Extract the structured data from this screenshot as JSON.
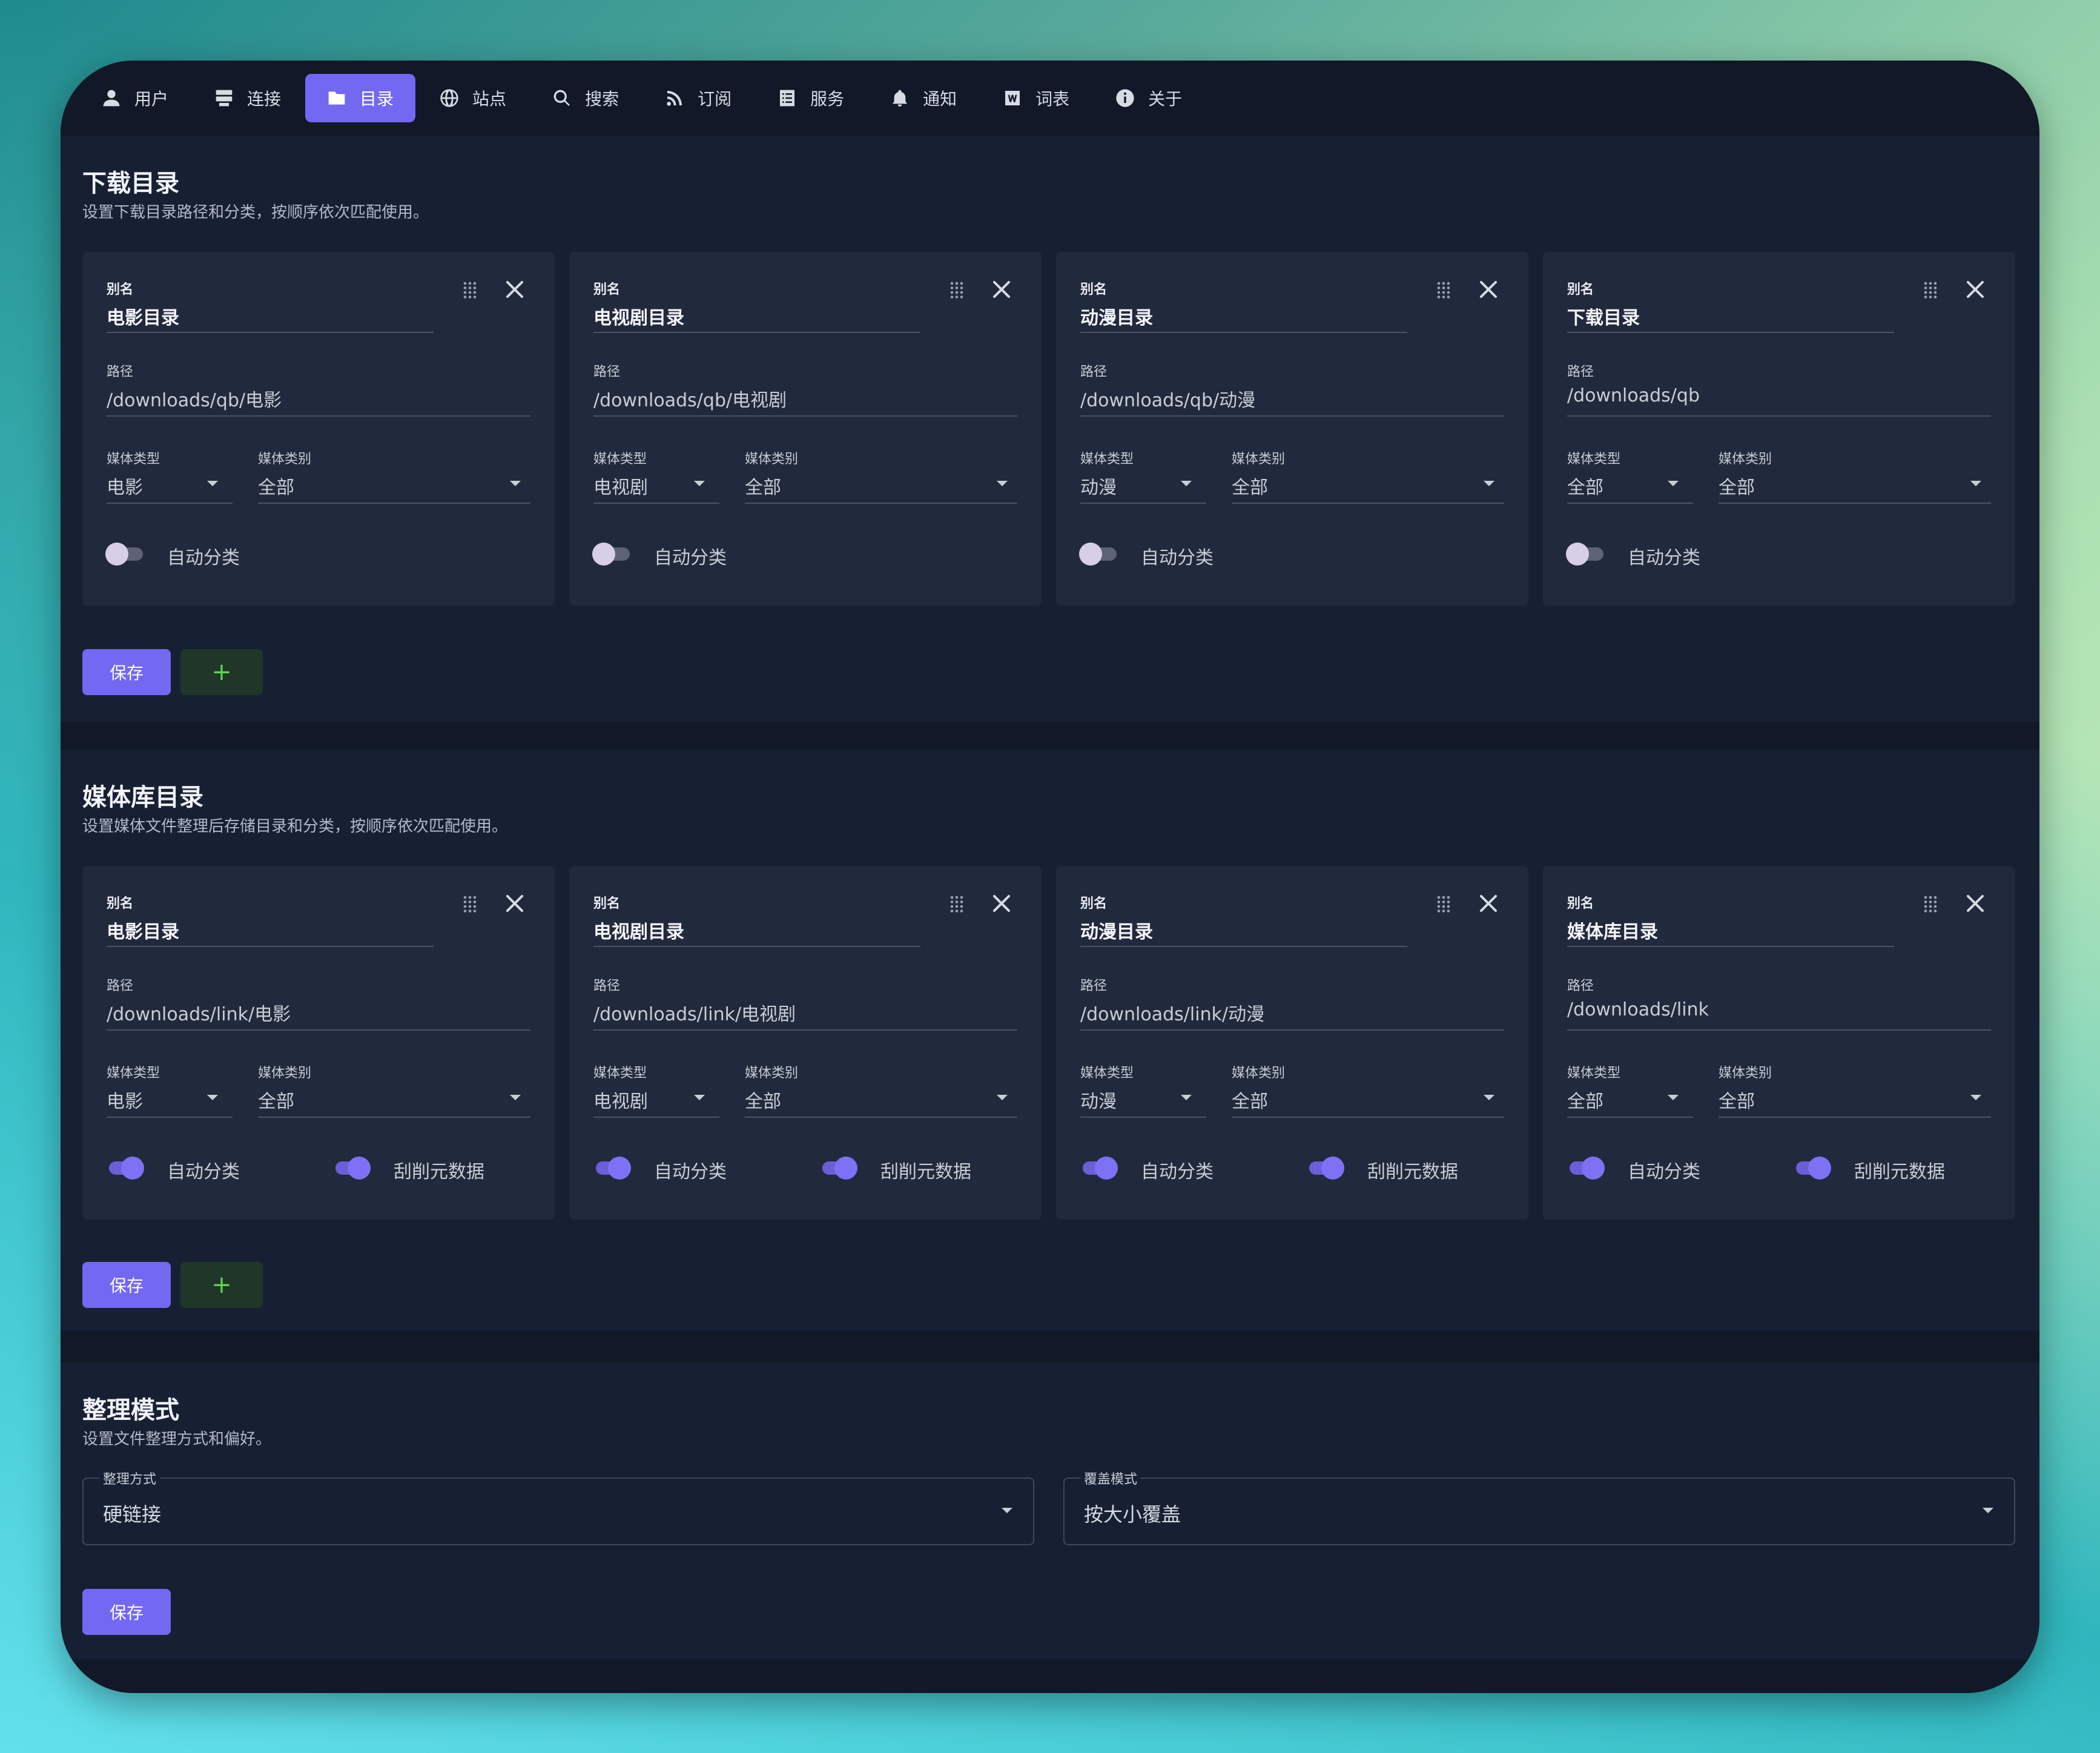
{
  "nav": {
    "tabs": [
      {
        "label": "用户",
        "icon": "user-icon",
        "active": false
      },
      {
        "label": "连接",
        "icon": "server-icon",
        "active": false
      },
      {
        "label": "目录",
        "icon": "folder-icon",
        "active": true
      },
      {
        "label": "站点",
        "icon": "globe-icon",
        "active": false
      },
      {
        "label": "搜索",
        "icon": "search-icon",
        "active": false
      },
      {
        "label": "订阅",
        "icon": "rss-icon",
        "active": false
      },
      {
        "label": "服务",
        "icon": "list-icon",
        "active": false
      },
      {
        "label": "通知",
        "icon": "bell-icon",
        "active": false
      },
      {
        "label": "词表",
        "icon": "word-icon",
        "active": false
      },
      {
        "label": "关于",
        "icon": "info-icon",
        "active": false
      }
    ]
  },
  "labels": {
    "alias": "别名",
    "path": "路径",
    "media_type": "媒体类型",
    "media_category": "媒体类别",
    "auto_category": "自动分类",
    "scrape": "刮削元数据",
    "save": "保存",
    "add": "+"
  },
  "download": {
    "title": "下载目录",
    "desc": "设置下载目录路径和分类，按顺序依次匹配使用。",
    "cards": [
      {
        "alias": "电影目录",
        "path": "/downloads/qb/电影",
        "type": "电影",
        "category": "全部",
        "auto": false
      },
      {
        "alias": "电视剧目录",
        "path": "/downloads/qb/电视剧",
        "type": "电视剧",
        "category": "全部",
        "auto": false
      },
      {
        "alias": "动漫目录",
        "path": "/downloads/qb/动漫",
        "type": "动漫",
        "category": "全部",
        "auto": false
      },
      {
        "alias": "下载目录",
        "path": "/downloads/qb",
        "type": "全部",
        "category": "全部",
        "auto": false
      }
    ]
  },
  "library": {
    "title": "媒体库目录",
    "desc": "设置媒体文件整理后存储目录和分类，按顺序依次匹配使用。",
    "cards": [
      {
        "alias": "电影目录",
        "path": "/downloads/link/电影",
        "type": "电影",
        "category": "全部",
        "auto": true,
        "scrape": true
      },
      {
        "alias": "电视剧目录",
        "path": "/downloads/link/电视剧",
        "type": "电视剧",
        "category": "全部",
        "auto": true,
        "scrape": true
      },
      {
        "alias": "动漫目录",
        "path": "/downloads/link/动漫",
        "type": "动漫",
        "category": "全部",
        "auto": true,
        "scrape": true
      },
      {
        "alias": "媒体库目录",
        "path": "/downloads/link",
        "type": "全部",
        "category": "全部",
        "auto": true,
        "scrape": true
      }
    ]
  },
  "organize": {
    "title": "整理模式",
    "desc": "设置文件整理方式和偏好。",
    "method_label": "整理方式",
    "method_value": "硬链接",
    "overwrite_label": "覆盖模式",
    "overwrite_value": "按大小覆盖"
  },
  "colors": {
    "accent": "#7368f2",
    "background": "#111827",
    "card": "#212a3c",
    "add_button_text": "#5fd34f"
  }
}
